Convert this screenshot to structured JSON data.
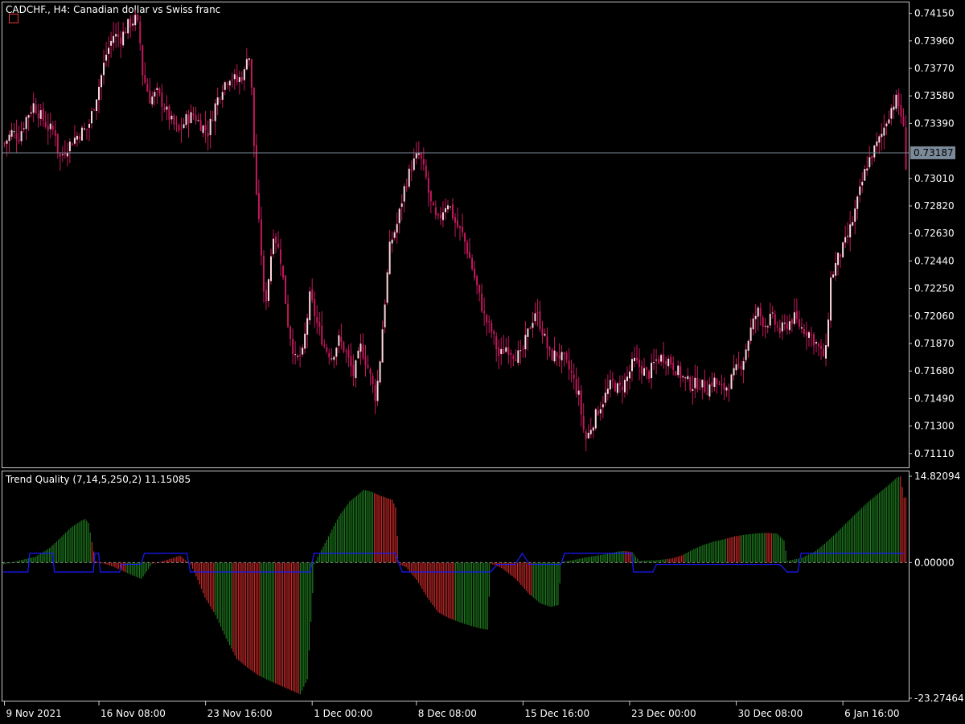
{
  "chart_data": [
    {
      "type": "candlestick",
      "title": "CADCHF., H4:  Canadian dollar vs Swiss franc",
      "ylim": [
        0.7102,
        0.7422
      ],
      "y_ticks": [
        "0.74150",
        "0.73960",
        "0.73770",
        "0.73580",
        "0.73390",
        "0.73010",
        "0.72820",
        "0.72630",
        "0.72440",
        "0.72250",
        "0.72060",
        "0.71870",
        "0.71680",
        "0.71490",
        "0.71300",
        "0.71110"
      ],
      "current_price": 0.73187,
      "current_price_label": "0.73187",
      "close_path": [
        [
          0,
          0.7325
        ],
        [
          4,
          0.7333
        ],
        [
          8,
          0.733
        ],
        [
          12,
          0.7343
        ],
        [
          16,
          0.7352
        ],
        [
          20,
          0.7344
        ],
        [
          24,
          0.7336
        ],
        [
          28,
          0.7333
        ],
        [
          30,
          0.7314
        ],
        [
          34,
          0.7322
        ],
        [
          38,
          0.7328
        ],
        [
          42,
          0.7333
        ],
        [
          46,
          0.7336
        ],
        [
          52,
          0.7365
        ],
        [
          56,
          0.7387
        ],
        [
          60,
          0.74
        ],
        [
          64,
          0.7398
        ],
        [
          68,
          0.7407
        ],
        [
          72,
          0.7411
        ],
        [
          74,
          0.7404
        ],
        [
          76,
          0.7373
        ],
        [
          80,
          0.7356
        ],
        [
          84,
          0.736
        ],
        [
          88,
          0.735
        ],
        [
          92,
          0.734
        ],
        [
          96,
          0.7333
        ],
        [
          100,
          0.7342
        ],
        [
          104,
          0.7345
        ],
        [
          108,
          0.7338
        ],
        [
          112,
          0.7333
        ],
        [
          116,
          0.7352
        ],
        [
          120,
          0.7365
        ],
        [
          124,
          0.7372
        ],
        [
          128,
          0.7368
        ],
        [
          132,
          0.7374
        ],
        [
          134,
          0.7395
        ],
        [
          136,
          0.736
        ],
        [
          137,
          0.733
        ],
        [
          139,
          0.728
        ],
        [
          141,
          0.7255
        ],
        [
          143,
          0.721
        ],
        [
          145,
          0.723
        ],
        [
          148,
          0.7265
        ],
        [
          152,
          0.7245
        ],
        [
          156,
          0.72
        ],
        [
          160,
          0.7175
        ],
        [
          164,
          0.718
        ],
        [
          168,
          0.722
        ],
        [
          172,
          0.72
        ],
        [
          176,
          0.7185
        ],
        [
          180,
          0.7178
        ],
        [
          184,
          0.719
        ],
        [
          188,
          0.718
        ],
        [
          192,
          0.7165
        ],
        [
          196,
          0.7185
        ],
        [
          200,
          0.717
        ],
        [
          204,
          0.715
        ],
        [
          206,
          0.7168
        ],
        [
          208,
          0.72
        ],
        [
          212,
          0.7255
        ],
        [
          216,
          0.727
        ],
        [
          220,
          0.7295
        ],
        [
          224,
          0.731
        ],
        [
          228,
          0.7318
        ],
        [
          232,
          0.73
        ],
        [
          234,
          0.7285
        ],
        [
          238,
          0.727
        ],
        [
          242,
          0.7282
        ],
        [
          244,
          0.7285
        ],
        [
          248,
          0.727
        ],
        [
          252,
          0.7262
        ],
        [
          256,
          0.7245
        ],
        [
          260,
          0.7225
        ],
        [
          264,
          0.7205
        ],
        [
          268,
          0.7195
        ],
        [
          272,
          0.7178
        ],
        [
          276,
          0.7185
        ],
        [
          280,
          0.718
        ],
        [
          284,
          0.7178
        ],
        [
          288,
          0.7195
        ],
        [
          292,
          0.721
        ],
        [
          296,
          0.7195
        ],
        [
          300,
          0.7178
        ],
        [
          304,
          0.718
        ],
        [
          308,
          0.7175
        ],
        [
          312,
          0.7165
        ],
        [
          316,
          0.715
        ],
        [
          318,
          0.713
        ],
        [
          320,
          0.712
        ],
        [
          322,
          0.7128
        ],
        [
          326,
          0.714
        ],
        [
          330,
          0.715
        ],
        [
          334,
          0.716
        ],
        [
          338,
          0.7155
        ],
        [
          342,
          0.7162
        ],
        [
          346,
          0.7175
        ],
        [
          350,
          0.717
        ],
        [
          354,
          0.7165
        ],
        [
          358,
          0.7175
        ],
        [
          362,
          0.7178
        ],
        [
          366,
          0.7175
        ],
        [
          370,
          0.7168
        ],
        [
          374,
          0.7162
        ],
        [
          378,
          0.7158
        ],
        [
          382,
          0.716
        ],
        [
          386,
          0.7155
        ],
        [
          390,
          0.7162
        ],
        [
          394,
          0.7155
        ],
        [
          398,
          0.7158
        ],
        [
          402,
          0.7168
        ],
        [
          406,
          0.7175
        ],
        [
          410,
          0.7195
        ],
        [
          414,
          0.721
        ],
        [
          418,
          0.72
        ],
        [
          422,
          0.7205
        ],
        [
          426,
          0.7195
        ],
        [
          430,
          0.72
        ],
        [
          434,
          0.7205
        ],
        [
          438,
          0.7198
        ],
        [
          442,
          0.7195
        ],
        [
          446,
          0.7188
        ],
        [
          450,
          0.7178
        ],
        [
          452,
          0.7182
        ],
        [
          454,
          0.723
        ],
        [
          458,
          0.7245
        ],
        [
          462,
          0.7255
        ],
        [
          466,
          0.727
        ],
        [
          470,
          0.729
        ],
        [
          474,
          0.731
        ],
        [
          478,
          0.732
        ],
        [
          482,
          0.733
        ],
        [
          486,
          0.7345
        ],
        [
          490,
          0.7356
        ],
        [
          492,
          0.735
        ],
        [
          494,
          0.734
        ],
        [
          496,
          0.7305
        ]
      ],
      "x_ticks": [
        {
          "label": "9 Nov 2021",
          "bar": 0
        },
        {
          "label": "16 Nov 08:00",
          "bar": 39
        },
        {
          "label": "23 Nov 16:00",
          "bar": 83
        },
        {
          "label": "1 Dec 00:00",
          "bar": 127
        },
        {
          "label": "8 Dec 08:00",
          "bar": 170
        },
        {
          "label": "15 Dec 16:00",
          "bar": 214
        },
        {
          "label": "23 Dec 00:00",
          "bar": 258
        },
        {
          "label": "30 Dec 08:00",
          "bar": 302
        },
        {
          "label": "6 Jan 16:00",
          "bar": 346
        }
      ],
      "bar_count": 373,
      "colors": {
        "bull": "#ffd8dc",
        "bear": "#c2185b",
        "wick": "#c2185b",
        "price_line": "#7a8a99",
        "price_tag_bg": "#7a8a99",
        "frame": "#c8c8c8"
      }
    },
    {
      "type": "histogram",
      "title": "Trend Quality (7,14,5,250,2) 11.15085",
      "ylim": [
        -23.27464,
        14.82094
      ],
      "y_ticks": [
        "14.82094",
        "0.00000",
        "-23.27464"
      ],
      "profile": [
        [
          0,
          -0.3
        ],
        [
          8,
          0.3
        ],
        [
          18,
          1.0
        ],
        [
          26,
          2.5
        ],
        [
          32,
          4.2
        ],
        [
          38,
          6.0
        ],
        [
          44,
          7.2
        ],
        [
          46,
          7.5
        ],
        [
          48,
          6.8
        ],
        [
          52,
          0.3
        ],
        [
          58,
          -0.3
        ],
        [
          62,
          -0.7
        ],
        [
          70,
          -1.8
        ],
        [
          78,
          -2.8
        ],
        [
          84,
          -0.2
        ],
        [
          92,
          0.4
        ],
        [
          100,
          1.2
        ],
        [
          106,
          -0.4
        ],
        [
          110,
          -3.0
        ],
        [
          114,
          -6.0
        ],
        [
          120,
          -9.0
        ],
        [
          126,
          -13.0
        ],
        [
          132,
          -16.5
        ],
        [
          138,
          -18.0
        ],
        [
          144,
          -19.3
        ],
        [
          150,
          -20.2
        ],
        [
          156,
          -21.0
        ],
        [
          162,
          -21.8
        ],
        [
          168,
          -22.6
        ],
        [
          172,
          -20.0
        ],
        [
          176,
          -0.3
        ],
        [
          178,
          1.0
        ],
        [
          184,
          4.5
        ],
        [
          190,
          8.0
        ],
        [
          196,
          10.5
        ],
        [
          202,
          12.0
        ],
        [
          204,
          12.5
        ],
        [
          208,
          12.2
        ],
        [
          214,
          11.4
        ],
        [
          220,
          10.8
        ],
        [
          222,
          9.5
        ],
        [
          224,
          -0.3
        ],
        [
          228,
          -0.8
        ],
        [
          234,
          -3.0
        ],
        [
          240,
          -6.0
        ],
        [
          246,
          -8.5
        ],
        [
          252,
          -9.5
        ],
        [
          258,
          -10.2
        ],
        [
          264,
          -10.8
        ],
        [
          270,
          -11.3
        ],
        [
          274,
          -11.5
        ],
        [
          276,
          -0.2
        ],
        [
          282,
          -0.9
        ],
        [
          290,
          -2.8
        ],
        [
          298,
          -5.5
        ],
        [
          304,
          -7.0
        ],
        [
          310,
          -7.6
        ],
        [
          314,
          -7.3
        ],
        [
          316,
          0.1
        ],
        [
          322,
          0.4
        ],
        [
          330,
          0.9
        ],
        [
          336,
          1.2
        ],
        [
          342,
          1.5
        ],
        [
          348,
          1.9
        ],
        [
          352,
          2.0
        ],
        [
          356,
          1.8
        ],
        [
          360,
          0.3
        ],
        [
          370,
          0.4
        ],
        [
          378,
          0.7
        ],
        [
          384,
          1.2
        ],
        [
          390,
          2.2
        ],
        [
          396,
          3.0
        ],
        [
          402,
          3.6
        ],
        [
          408,
          4.0
        ],
        [
          414,
          4.5
        ],
        [
          420,
          4.8
        ],
        [
          426,
          5.0
        ],
        [
          432,
          5.1
        ],
        [
          438,
          5.0
        ],
        [
          442,
          3.8
        ],
        [
          444,
          0.3
        ],
        [
          452,
          0.8
        ],
        [
          460,
          2.0
        ],
        [
          466,
          3.5
        ],
        [
          472,
          5.2
        ],
        [
          478,
          7.0
        ],
        [
          484,
          8.8
        ],
        [
          490,
          10.5
        ],
        [
          496,
          12.0
        ],
        [
          502,
          13.5
        ],
        [
          506,
          14.6
        ],
        [
          508,
          14.8
        ],
        [
          510,
          11.15
        ]
      ],
      "color_runs": [
        {
          "from": 0,
          "to": 30,
          "color": "green"
        },
        {
          "from": 30,
          "to": 50,
          "color": "green"
        },
        {
          "from": 50,
          "to": 54,
          "color": "red"
        },
        {
          "from": 54,
          "to": 70,
          "color": "red"
        },
        {
          "from": 70,
          "to": 84,
          "color": "green"
        },
        {
          "from": 84,
          "to": 110,
          "color": "red"
        },
        {
          "from": 110,
          "to": 120,
          "color": "red"
        },
        {
          "from": 120,
          "to": 130,
          "color": "green"
        },
        {
          "from": 130,
          "to": 146,
          "color": "red"
        },
        {
          "from": 146,
          "to": 154,
          "color": "green"
        },
        {
          "from": 154,
          "to": 168,
          "color": "red"
        },
        {
          "from": 168,
          "to": 176,
          "color": "green"
        },
        {
          "from": 176,
          "to": 210,
          "color": "green"
        },
        {
          "from": 210,
          "to": 226,
          "color": "red"
        },
        {
          "from": 226,
          "to": 256,
          "color": "red"
        },
        {
          "from": 256,
          "to": 276,
          "color": "green"
        },
        {
          "from": 276,
          "to": 300,
          "color": "red"
        },
        {
          "from": 300,
          "to": 316,
          "color": "green"
        },
        {
          "from": 316,
          "to": 352,
          "color": "green"
        },
        {
          "from": 352,
          "to": 356,
          "color": "red"
        },
        {
          "from": 356,
          "to": 376,
          "color": "green"
        },
        {
          "from": 376,
          "to": 386,
          "color": "red"
        },
        {
          "from": 386,
          "to": 410,
          "color": "green"
        },
        {
          "from": 410,
          "to": 418,
          "color": "red"
        },
        {
          "from": 418,
          "to": 432,
          "color": "green"
        },
        {
          "from": 432,
          "to": 436,
          "color": "red"
        },
        {
          "from": 436,
          "to": 442,
          "color": "green"
        },
        {
          "from": 442,
          "to": 508,
          "color": "green"
        },
        {
          "from": 508,
          "to": 512,
          "color": "red"
        }
      ],
      "signal_line": [
        [
          0,
          -1.6
        ],
        [
          14,
          -1.6
        ],
        [
          15,
          1.6
        ],
        [
          28,
          1.6
        ],
        [
          29,
          -1.6
        ],
        [
          44,
          -1.6
        ],
        [
          48,
          -1.6
        ],
        [
          51,
          -1.6
        ],
        [
          52,
          1.6
        ],
        [
          54,
          1.6
        ],
        [
          55,
          -1.6
        ],
        [
          66,
          -1.6
        ],
        [
          67,
          -0.3
        ],
        [
          78,
          -0.3
        ],
        [
          80,
          1.6
        ],
        [
          98,
          1.6
        ],
        [
          100,
          1.6
        ],
        [
          104,
          1.6
        ],
        [
          106,
          -1.6
        ],
        [
          124,
          -1.6
        ],
        [
          128,
          -1.6
        ],
        [
          174,
          -1.6
        ],
        [
          176,
          1.6
        ],
        [
          194,
          1.6
        ],
        [
          222,
          1.6
        ],
        [
          226,
          -1.6
        ],
        [
          246,
          -1.6
        ],
        [
          258,
          -1.6
        ],
        [
          276,
          -1.6
        ],
        [
          280,
          -0.3
        ],
        [
          290,
          -0.3
        ],
        [
          294,
          1.6
        ],
        [
          298,
          -0.3
        ],
        [
          316,
          -0.3
        ],
        [
          318,
          1.6
        ],
        [
          330,
          1.6
        ],
        [
          350,
          1.6
        ],
        [
          356,
          1.6
        ],
        [
          357,
          -1.6
        ],
        [
          368,
          -1.6
        ],
        [
          370,
          -0.3
        ],
        [
          380,
          -0.3
        ],
        [
          390,
          -0.3
        ],
        [
          400,
          -0.3
        ],
        [
          410,
          -0.3
        ],
        [
          420,
          -0.3
        ],
        [
          440,
          -0.3
        ],
        [
          444,
          -1.6
        ],
        [
          450,
          -1.6
        ],
        [
          452,
          1.6
        ],
        [
          466,
          1.6
        ],
        [
          480,
          1.6
        ],
        [
          510,
          1.6
        ]
      ],
      "histogram_bar_count": 512,
      "colors": {
        "up": "#1e7b1e",
        "down": "#c62828",
        "signal": "#1a1aff",
        "zero_dash": "#8c8c8c"
      }
    }
  ]
}
